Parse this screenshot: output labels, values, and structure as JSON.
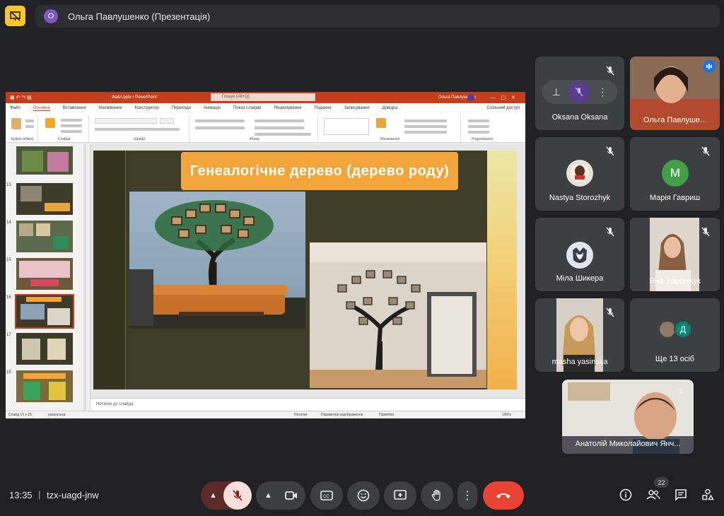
{
  "presenter": {
    "initial": "О",
    "label": "Ольга Павлушенко (Презентація)"
  },
  "ppt": {
    "filename": "Файл.pptx • PowerPoint",
    "search_placeholder": "Пошук (Alt+Q)",
    "user": "Ольга Павлушенко",
    "menu": [
      "Файл",
      "Основне",
      "Вставлення",
      "Малювання",
      "Конструктор",
      "Переходи",
      "Анімація",
      "Показ слайдів",
      "Рецензування",
      "Подання",
      "Записування",
      "Довідка"
    ],
    "active_menu": "Основне",
    "share": "Спільний доступ",
    "ribbon_groups": [
      "Буфер обміну",
      "Слайди",
      "Шрифт",
      "Абзац",
      "Малювання",
      "Редагування"
    ],
    "slide_numbers": [
      "13",
      "14",
      "15",
      "16",
      "17",
      "18"
    ],
    "selected_slide": "16",
    "slide_title": "Генеалогічне дерево (дерево роду)",
    "notes_placeholder": "Нотатки до слайда",
    "status_slide": "Слайд 16 з 25",
    "status_lang": "українська",
    "status_notes": "Нотатки",
    "status_display": "Параметри відображення",
    "status_comments": "Примітки",
    "zoom": "100%"
  },
  "participants": [
    {
      "name": "Oksana Oksana"
    },
    {
      "name": "Ольга Павлуше..."
    },
    {
      "name": "Nastya Storozhyk"
    },
    {
      "name": "Марія Гавриш",
      "initial": "М",
      "color": "#43a047"
    },
    {
      "name": "Міла Шикера"
    },
    {
      "name": "Яна Хоронжук"
    },
    {
      "name": "masha yasinska"
    },
    {
      "name": "Ще 13 осіб",
      "initial": "Д"
    },
    {
      "name": "Анатолій Миколайович Янч..."
    }
  ],
  "meeting": {
    "time": "13:35",
    "separator": "|",
    "code": "tzx-uagd-jnw",
    "people_count": "22"
  },
  "icons": [
    "present-icon",
    "mic-off-icon",
    "camera-icon",
    "captions-icon",
    "emoji-icon",
    "present-screen-icon",
    "raise-hand-icon",
    "more-options-icon",
    "end-call-icon",
    "info-icon",
    "people-icon",
    "chat-icon",
    "activities-icon",
    "pin-icon",
    "speaking-icon"
  ],
  "colors": {
    "end_call": "#ea4335",
    "mic_active_bg": "#f9dedc",
    "accent_ppt": "#c43e1c",
    "slide_title_bg": "#f2a53a"
  }
}
